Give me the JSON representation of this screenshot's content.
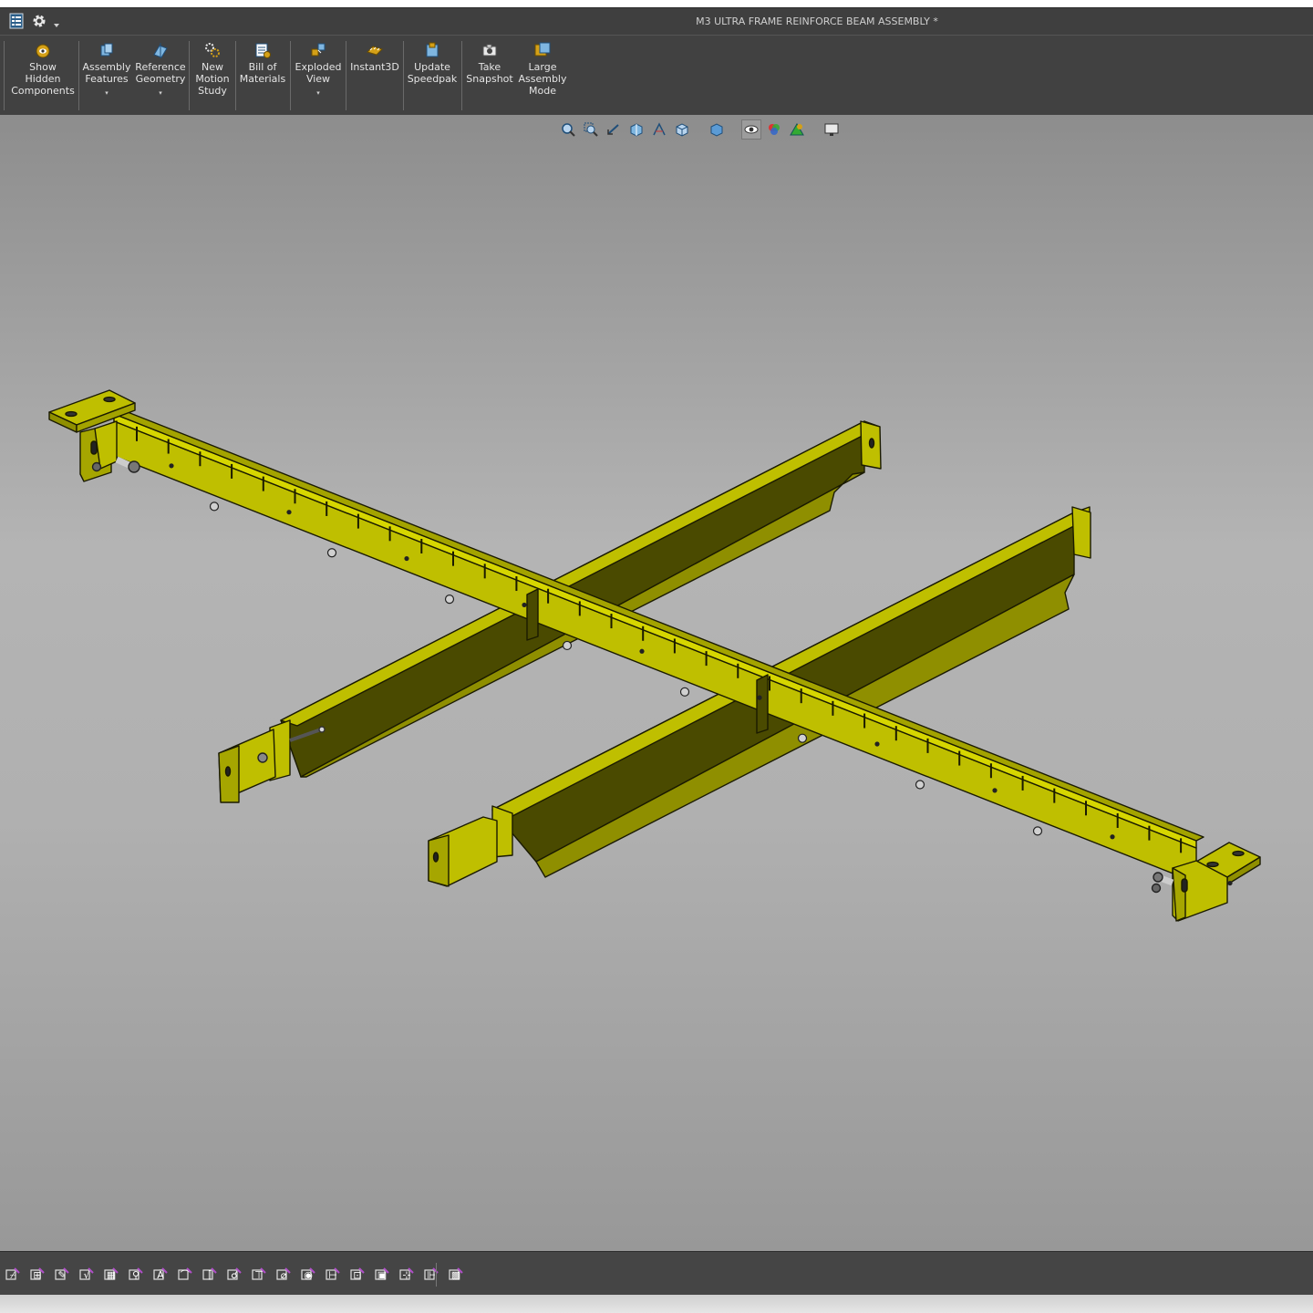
{
  "window": {
    "title": "M3 ULTRA FRAME REINFORCE BEAM ASSEMBLY *"
  },
  "titlebar_icons": [
    "property-manager-icon",
    "gear-icon",
    "dropdown-arrow-icon"
  ],
  "ribbon": {
    "buttons": [
      {
        "id": "show-hidden",
        "label": "Show\nHidden\nComponents",
        "icon": "show-hidden-icon",
        "dropdown": false
      },
      {
        "id": "assembly-features",
        "label": "Assembly\nFeatures",
        "icon": "assembly-features-icon",
        "dropdown": true
      },
      {
        "id": "reference-geometry",
        "label": "Reference\nGeometry",
        "icon": "reference-geometry-icon",
        "dropdown": true
      },
      {
        "id": "new-motion-study",
        "label": "New\nMotion\nStudy",
        "icon": "motion-study-icon",
        "dropdown": false
      },
      {
        "id": "bill-of-materials",
        "label": "Bill of\nMaterials",
        "icon": "bom-icon",
        "dropdown": false
      },
      {
        "id": "exploded-view",
        "label": "Exploded\nView",
        "icon": "exploded-view-icon",
        "dropdown": true
      },
      {
        "id": "instant3d",
        "label": "Instant3D",
        "icon": "instant3d-icon",
        "dropdown": false
      },
      {
        "id": "update-speedpak",
        "label": "Update\nSpeedpak",
        "icon": "speedpak-icon",
        "dropdown": false
      },
      {
        "id": "take-snapshot",
        "label": "Take\nSnapshot",
        "icon": "camera-icon",
        "dropdown": false
      },
      {
        "id": "large-assembly-mode",
        "label": "Large\nAssembly\nMode",
        "icon": "large-assembly-icon",
        "dropdown": false
      }
    ],
    "dropdown_glyph": "▾"
  },
  "heads_up_toolbar": [
    "zoom-to-fit-icon",
    "zoom-to-area-icon",
    "previous-view-icon",
    "section-view-icon",
    "dynamic-annotation-icon",
    "view-orientation-icon",
    "display-style-icon",
    "hide-show-items-icon",
    "edit-appearance-icon",
    "apply-scene-icon",
    "view-settings-icon"
  ],
  "model": {
    "name": "reinforce-beam-assembly",
    "colors": {
      "face_light": "#bfbf00",
      "face_dark": "#4a4a00",
      "face_mid": "#8f8f00",
      "edge": "#1a1a00",
      "hardware": "#d8d8d8"
    }
  },
  "bottom_toolbar": [
    "smart-dimension-icon",
    "model-items-icon",
    "spell-checker-icon",
    "format-painter-icon",
    "note-icon",
    "linear-note-pattern-icon",
    "balloon-icon",
    "auto-balloon-icon",
    "magnetic-line-icon",
    "surface-finish-icon",
    "weld-symbol-icon",
    "hole-callout-icon",
    "geometric-tolerance-icon",
    "datum-feature-icon",
    "datum-target-icon",
    "blocks-icon",
    "center-mark-icon",
    "centerline-icon",
    "area-hatch-icon"
  ]
}
